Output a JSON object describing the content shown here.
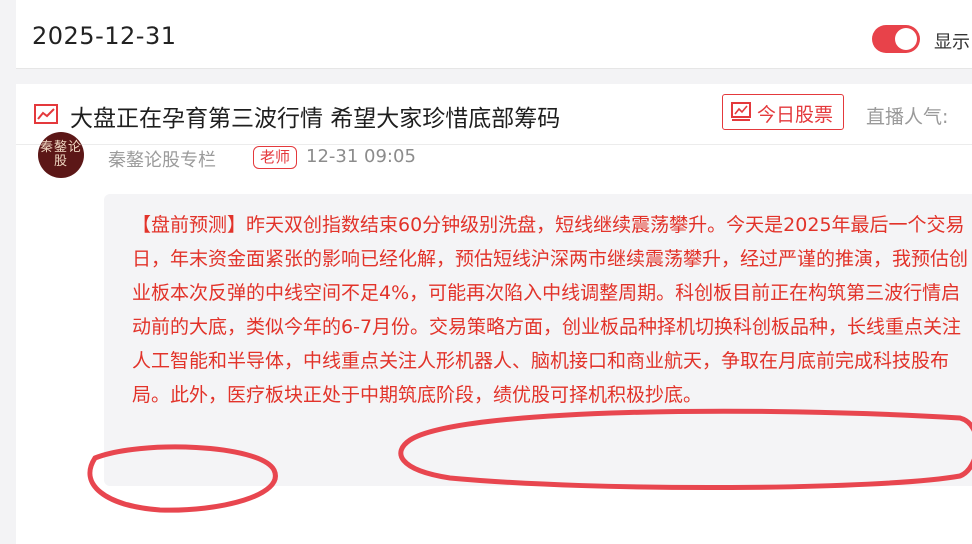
{
  "date_bar": {
    "date": "2025-12-31",
    "toggle_on": true,
    "toggle_label": "显示"
  },
  "post": {
    "title": "大盘正在孕育第三波行情 希望大家珍惜底部筹码",
    "title_icon": "trend-chart-icon",
    "stock_button_label": "今日股票",
    "live_popularity_label": "直播人气:",
    "avatar_text": "秦鏊论股",
    "author": "秦鏊论股专栏",
    "author_badge": "老师",
    "time": "12-31 09:05",
    "content": "【盘前预测】昨天双创指数结束60分钟级别洗盘，短线继续震荡攀升。今天是2025年最后一个交易日，年末资金面紧张的影响已经化解，预估短线沪深两市继续震荡攀升，经过严谨的推演，我预估创业板本次反弹的中线空间不足4%，可能再次陷入中线调整周期。科创板目前正在构筑第三波行情启动前的大底，类似今年的6-7月份。交易策略方面，创业板品种择机切换科创板品种，长线重点关注人工智能和半导体，中线重点关注人形机器人、脑机接口和商业航天，争取在月底前完成科技股布局。此外，医疗板块正处于中期筑底阶段，绩优股可择机积极抄底。"
  },
  "colors": {
    "accent_red": "#e4393c",
    "content_red": "#e2332a",
    "annotation_red": "#e8464f"
  }
}
